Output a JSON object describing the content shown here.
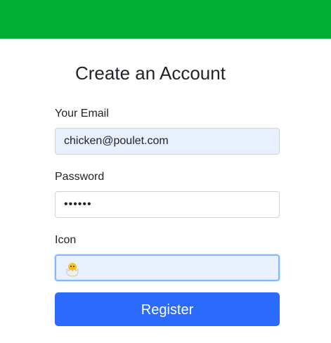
{
  "header": {
    "bar_color": "#00ad35"
  },
  "form": {
    "title": "Create an Account",
    "email": {
      "label": "Your Email",
      "value": "chicken@poulet.com"
    },
    "password": {
      "label": "Password",
      "value": "••••••"
    },
    "icon": {
      "label": "Icon",
      "value": "🐣",
      "icon_name": "hatching-chick-icon"
    },
    "register_label": "Register",
    "accent_color": "#2a6afc"
  }
}
